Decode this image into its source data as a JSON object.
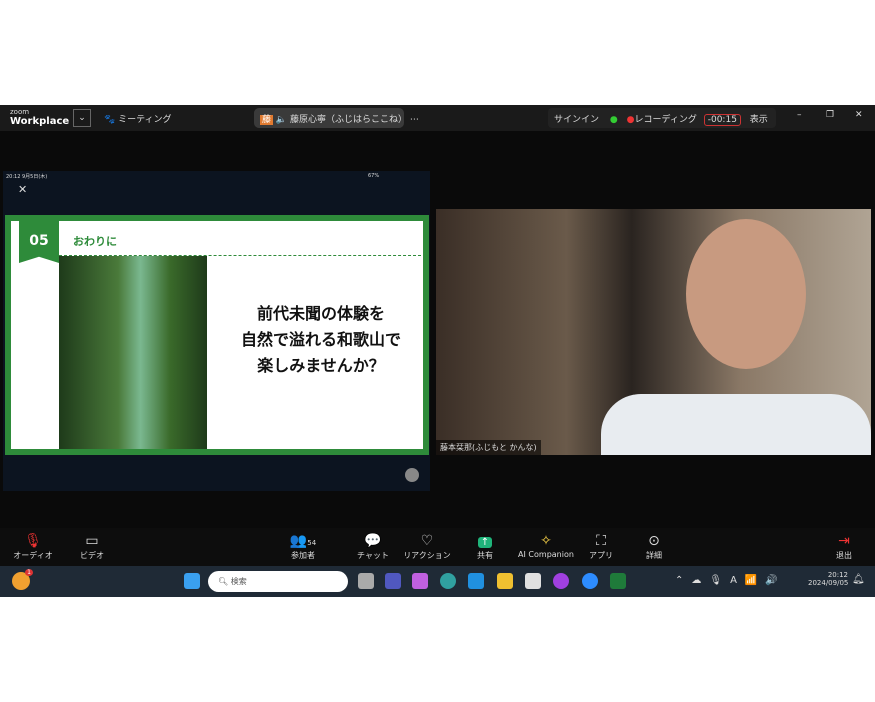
{
  "topbar": {
    "logo_small": "zoom",
    "logo": "Workplace",
    "meeting": "ミーティング",
    "speaker": "藤原心寧（ふじはらここね）",
    "speaker_initial": "藤",
    "signin": "サインイン",
    "recording": "レコーディング",
    "timer": "-00:15",
    "view": "表示"
  },
  "ipad": {
    "time": "20:12  9月5日(木)",
    "battery": "67%"
  },
  "slide": {
    "number": "05",
    "heading": "おわりに",
    "lines": [
      "前代未聞の体験を",
      "自然で溢れる和歌山で",
      "楽しみませんか？"
    ],
    "accent": "#2e8b3a"
  },
  "video": {
    "name": "藤本栞那(ふじもと かんな)"
  },
  "toolbar": {
    "audio": "オーディオ",
    "video": "ビデオ",
    "participants": "参加者",
    "participants_count": "54",
    "chat": "チャット",
    "reaction": "リアクション",
    "share": "共有",
    "ai": "AI Companion",
    "apps": "アプリ",
    "more": "詳細",
    "leave": "退出"
  },
  "taskbar": {
    "search": "検索",
    "time": "20:12",
    "date": "2024/09/05",
    "badge": "1"
  }
}
